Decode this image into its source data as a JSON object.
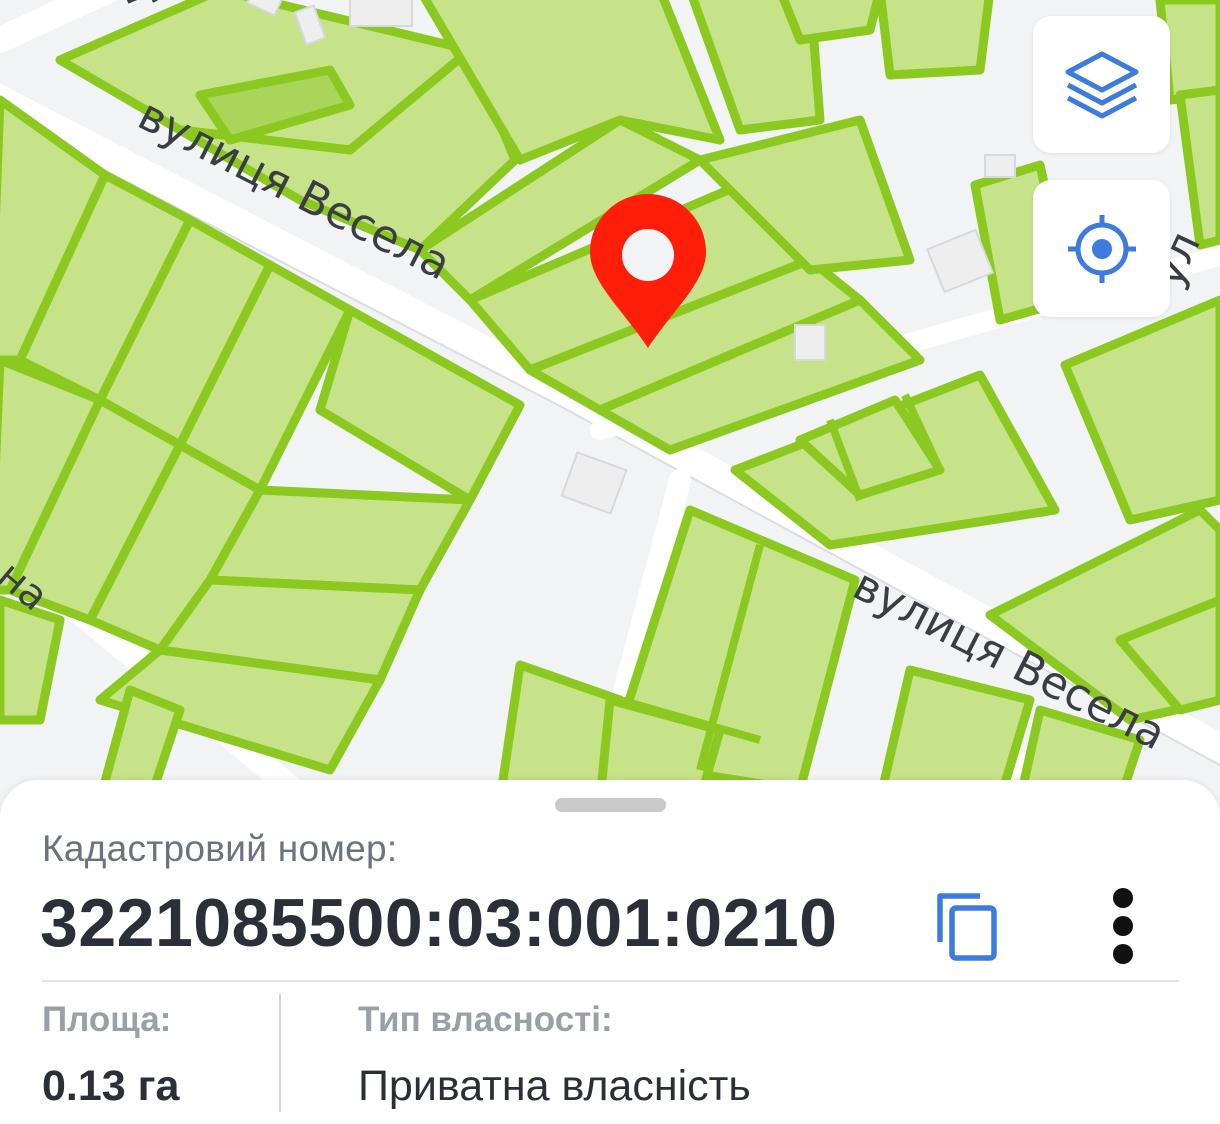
{
  "map": {
    "streets": [
      {
        "name": "вулиця Весела"
      },
      {
        "name": "вулиця Весела"
      },
      {
        "name": "ву"
      },
      {
        "name": "ул"
      },
      {
        "name": "на"
      }
    ],
    "marker_icon": "map-pin-icon",
    "parcel_color": "#c7e38a",
    "parcel_border_color": "#8cc920",
    "marker_color": "#ff1e0a"
  },
  "controls": {
    "layers_icon": "layers-icon",
    "locate_icon": "crosshair-target-icon",
    "accent_color": "#3d7be0"
  },
  "panel": {
    "cadastral_label": "Кадастровий номер:",
    "cadastral_number": "3221085500:03:001:0210",
    "copy_icon": "copy-icon",
    "more_icon": "more-vertical-icon",
    "area_label": "Площа:",
    "area_value": "0.13 га",
    "ownership_label": "Тип власності:",
    "ownership_value": "Приватна власність"
  }
}
